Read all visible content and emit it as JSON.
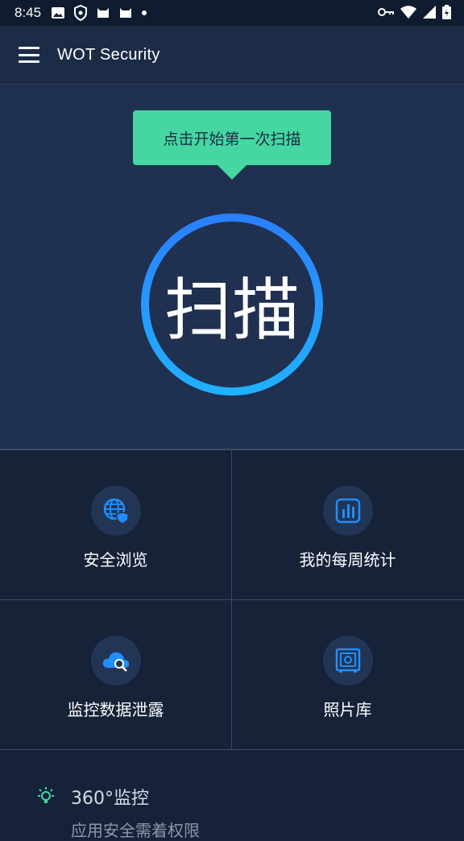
{
  "status_bar": {
    "time": "8:45",
    "left_icons": [
      "image-icon",
      "shield-icon",
      "cat-icon",
      "cat-icon",
      "dot-icon"
    ],
    "right_icons": [
      "key-icon",
      "wifi-icon",
      "signal-icon",
      "battery-icon"
    ]
  },
  "app_bar": {
    "title": "WOT Security",
    "menu_icon": "hamburger-menu-icon"
  },
  "hero": {
    "tooltip": "点击开始第一次扫描",
    "scan_label": "扫描",
    "accent_color": "#1f9bff",
    "tooltip_color": "#45d6a1"
  },
  "tiles": [
    {
      "label": "安全浏览",
      "icon": "globe-shield-icon"
    },
    {
      "label": "我的每周统计",
      "icon": "bar-chart-icon"
    },
    {
      "label": "监控数据泄露",
      "icon": "cloud-search-icon"
    },
    {
      "label": "照片库",
      "icon": "safe-vault-icon"
    }
  ],
  "monitor": {
    "label": "360°监控",
    "subtext": "应用安全需着权限",
    "icon": "lightbulb-icon"
  }
}
